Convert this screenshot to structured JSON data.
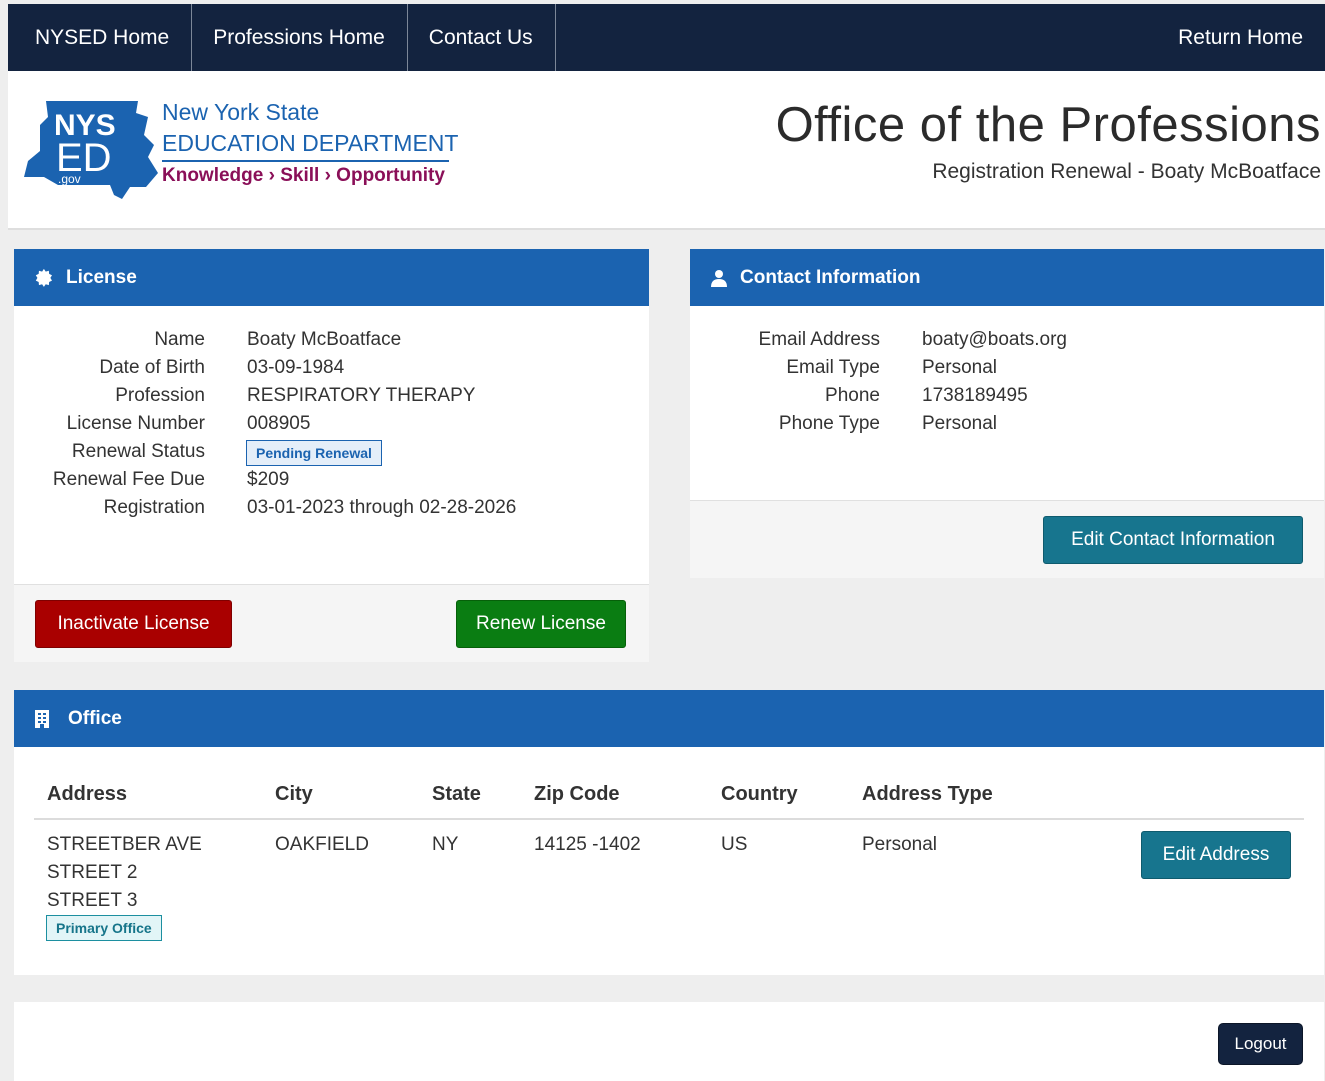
{
  "nav": {
    "home": "NYSED Home",
    "professions": "Professions Home",
    "contact": "Contact Us",
    "return": "Return Home"
  },
  "header": {
    "org_line1": "New York State",
    "org_line2": "EDUCATION DEPARTMENT",
    "org_tagline": "Knowledge › Skill › Opportunity",
    "logo_text_top": "NYS",
    "logo_text_mid": "ED",
    "logo_text_gov": ".gov",
    "title": "Office of the Professions",
    "subtitle": "Registration Renewal - Boaty McBoatface"
  },
  "license": {
    "heading": "License",
    "fields": [
      {
        "label": "Name",
        "value": "Boaty McBoatface"
      },
      {
        "label": "Date of Birth",
        "value": "03-09-1984"
      },
      {
        "label": "Profession",
        "value": "RESPIRATORY THERAPY"
      },
      {
        "label": "License Number",
        "value": "008905"
      },
      {
        "label": "Renewal Status",
        "value": "Pending Renewal"
      },
      {
        "label": "Renewal Fee Due",
        "value": "$209"
      },
      {
        "label": "Registration",
        "value": "03-01-2023 through 02-28-2026"
      }
    ],
    "inactivate_label": "Inactivate License",
    "renew_label": "Renew License"
  },
  "contact": {
    "heading": "Contact Information",
    "fields": [
      {
        "label": "Email Address",
        "value": "boaty@boats.org"
      },
      {
        "label": "Email Type",
        "value": "Personal"
      },
      {
        "label": "Phone",
        "value": "1738189495"
      },
      {
        "label": "Phone Type",
        "value": "Personal"
      }
    ],
    "edit_label": "Edit Contact Information"
  },
  "office": {
    "heading": "Office",
    "columns": [
      "Address",
      "City",
      "State",
      "Zip Code",
      "Country",
      "Address Type"
    ],
    "rows": [
      {
        "address": [
          "STREETBER AVE",
          "STREET 2",
          "STREET 3"
        ],
        "badge": "Primary Office",
        "city": "OAKFIELD",
        "state": "NY",
        "zip": "14125 -1402",
        "country": "US",
        "type": "Personal",
        "edit_label": "Edit Address"
      }
    ]
  },
  "footer": {
    "logout_label": "Logout"
  },
  "colors": {
    "nav_bg": "#13233f",
    "panel_header": "#1b63b0",
    "btn_red": "#a90000",
    "btn_green": "#0a7d12",
    "btn_teal": "#17758e"
  }
}
